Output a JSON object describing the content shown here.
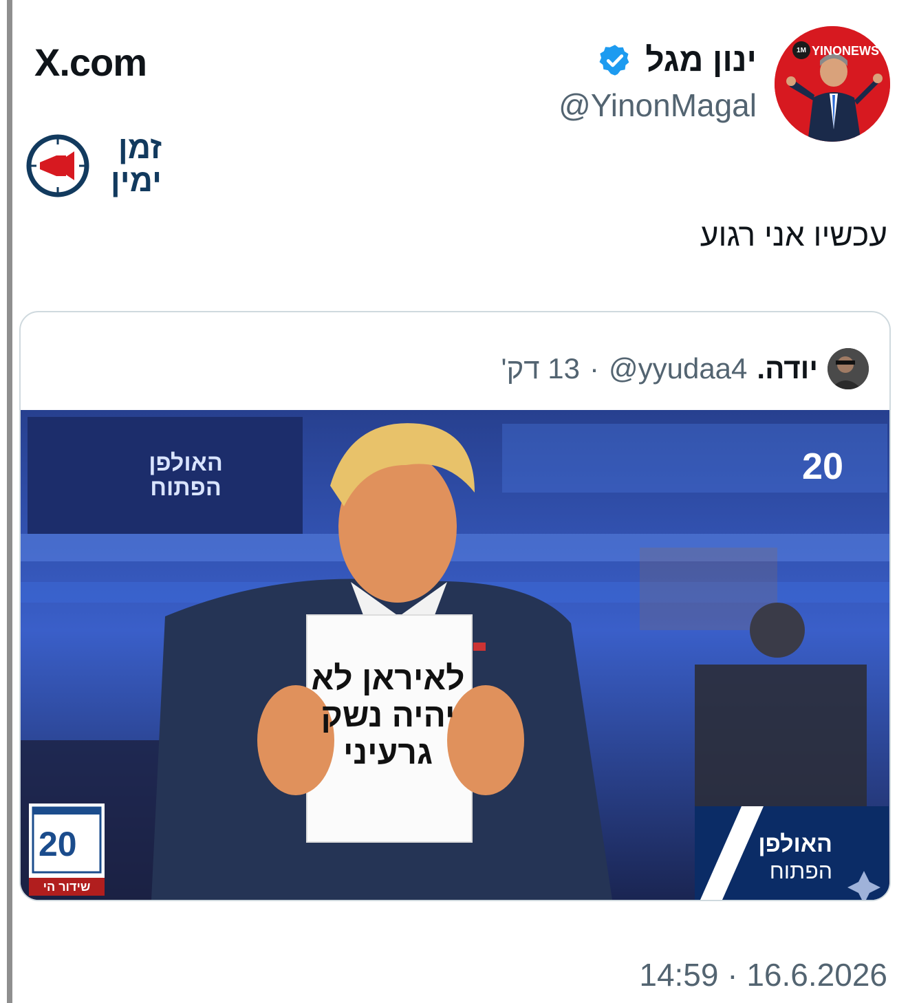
{
  "site": {
    "label": "X.com"
  },
  "watermark": {
    "name": "זמן ימין"
  },
  "author": {
    "name": "ינון מגל",
    "handle": "@YinonMagal",
    "avatar_channel": "YINONEWS",
    "avatar_badge": "1M",
    "verified": true
  },
  "tweet": {
    "text": "עכשיו אני רגוע",
    "timestamp": "14:59 · 16.6.2026"
  },
  "quote": {
    "name": "יודה.",
    "handle": "@yyudaa4",
    "separator": "·",
    "time": "13 דק'",
    "media": {
      "sign_text": "לאיראן לא יהיה נשק גרעיני",
      "studio_sign": "האולפן הפתוח",
      "channel_bug": "20",
      "lower_third_title": "האולפן",
      "lower_third_sub": "הפתוח",
      "corner_logo_label": "שידור הי"
    }
  },
  "colors": {
    "accent_verified": "#1d9bf0",
    "handle_gray": "#536471",
    "studio_blue": "#1f3a8a",
    "lower_third": "#0b2c66"
  }
}
